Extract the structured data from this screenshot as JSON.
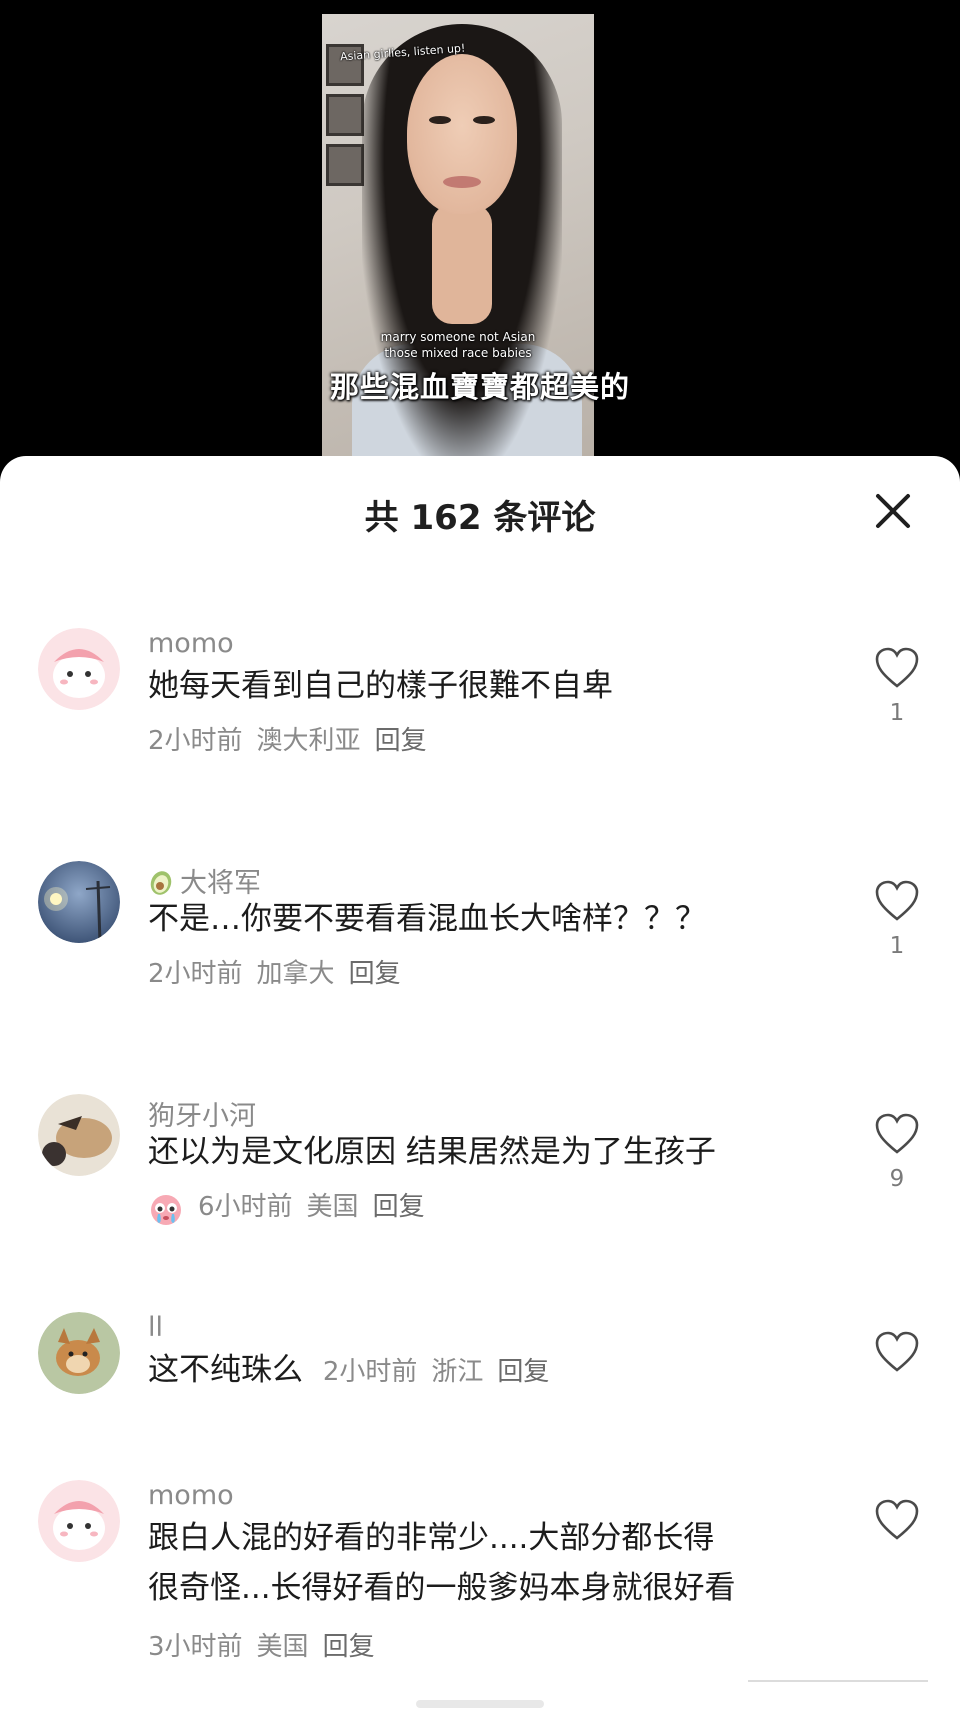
{
  "video": {
    "caption_top": "Asian girlies, listen up!",
    "caption_en_line1": "marry someone not Asian",
    "caption_en_line2": "those mixed race babies",
    "subtitle_zh": "那些混血寶寶都超美的"
  },
  "comments_panel": {
    "title": "共 162 条评论",
    "close_icon": "close-icon",
    "comments": [
      {
        "user": "momo",
        "text": "她每天看到自己的樣子很難不自卑",
        "time": "2小时前",
        "location": "澳大利亚",
        "reply": "回复",
        "likes": "1"
      },
      {
        "user": "大将军",
        "user_icon": "avocado-icon",
        "text": "不是…你要不要看看混血长大啥样？？？",
        "time": "2小时前",
        "location": "加拿大",
        "reply": "回复",
        "likes": "1"
      },
      {
        "user": "狗牙小河",
        "text": "还以为是文化原因 结果居然是为了生孩子",
        "meta_icon": "crying-face-emoji",
        "time": "6小时前",
        "location": "美国",
        "reply": "回复",
        "likes": "9"
      },
      {
        "user": "ll",
        "text": "这不纯珠么",
        "time": "2小时前",
        "location": "浙江",
        "reply": "回复",
        "likes": ""
      },
      {
        "user": "momo",
        "text_line1": "跟白人混的好看的非常少....大部分都长得",
        "text_line2": "很奇怪...长得好看的一般爹妈本身就很好看",
        "time": "3小时前",
        "location": "美国",
        "reply": "回复",
        "likes": ""
      }
    ]
  },
  "colors": {
    "sheet_background": "#ffffff",
    "text_primary": "#1c1c1c",
    "text_secondary": "#8a8a8a",
    "video_background": "#000000"
  }
}
